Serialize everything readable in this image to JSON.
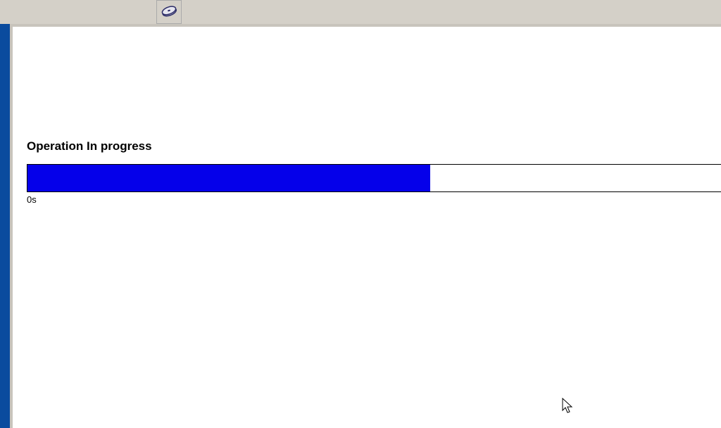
{
  "toolbar": {
    "icon_name": "disk-icon"
  },
  "progress": {
    "title": "Operation In progress",
    "percent": 58,
    "time_label": "0s",
    "fill_color": "#0500ea",
    "track_color": "#ffffff"
  }
}
